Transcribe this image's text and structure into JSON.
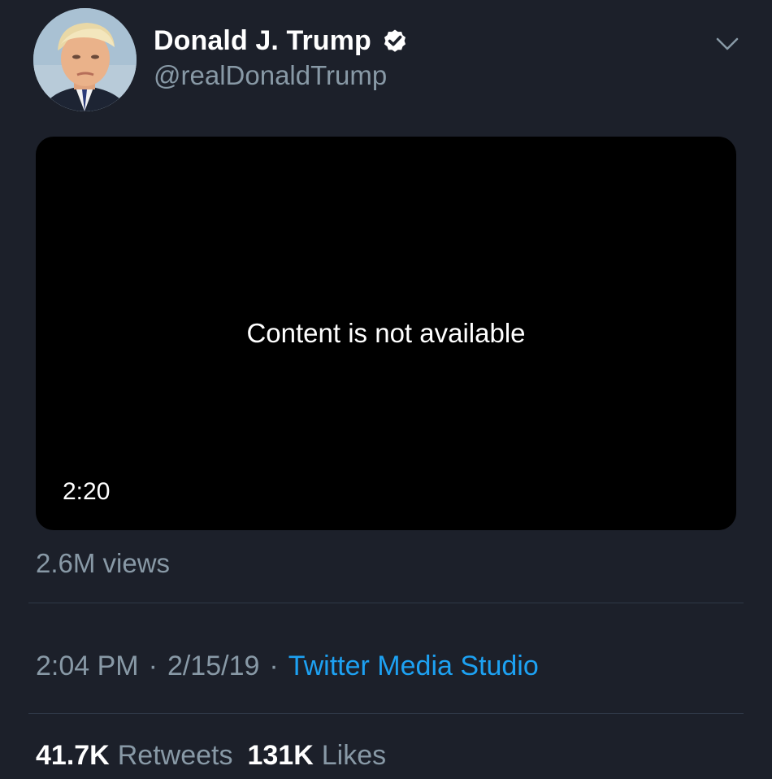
{
  "author": {
    "display_name": "Donald J. Trump",
    "handle": "@realDonaldTrump",
    "verified": true,
    "avatar_icon": "profile-photo"
  },
  "media": {
    "message": "Content is not available",
    "duration": "2:20"
  },
  "views": "2.6M views",
  "meta": {
    "time": "2:04 PM",
    "date": "2/15/19",
    "separator": "·",
    "source": "Twitter Media Studio"
  },
  "stats": {
    "retweets_count": "41.7K",
    "retweets_label": "Retweets",
    "likes_count": "131K",
    "likes_label": "Likes"
  },
  "colors": {
    "background": "#1c202a",
    "secondary_text": "#8899a6",
    "link": "#1da1f2",
    "media_background": "#000000"
  }
}
